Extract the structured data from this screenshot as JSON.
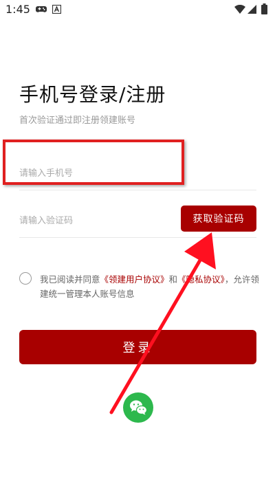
{
  "status_bar": {
    "time": "1:45",
    "icons": [
      "gamepad-icon",
      "a-box-icon",
      "wifi-icon",
      "signal-icon",
      "battery-icon"
    ]
  },
  "page": {
    "title": "手机号登录/注册",
    "subtitle": "首次验证通过即注册领建账号"
  },
  "form": {
    "phone_placeholder": "请输入手机号",
    "code_placeholder": "请输入验证码",
    "get_code_label": "获取验证码",
    "agreement": {
      "prefix": "我已阅读并同意",
      "user_agreement": "《领建用户协议》",
      "and": "和",
      "privacy_agreement": "《隐私协议》",
      "suffix": "，允许领建统一管理本人账号信息"
    },
    "login_label": "登录"
  },
  "third_party": {
    "wechat_icon": "wechat-icon"
  },
  "colors": {
    "primary": "#a80000",
    "highlight": "#e02020",
    "wechat": "#2db84d"
  }
}
